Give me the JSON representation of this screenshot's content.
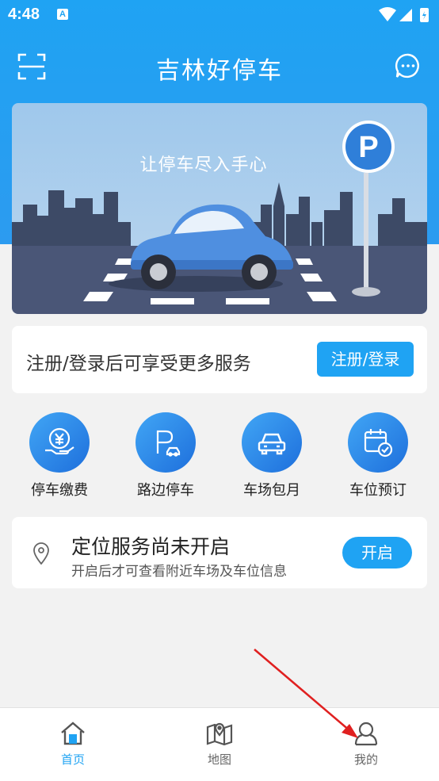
{
  "status_bar": {
    "time": "4:48",
    "notification_letter": "A"
  },
  "header": {
    "title": "吉林好停车",
    "scan_icon": "scan-icon",
    "message_icon": "chat-bubble-icon"
  },
  "banner": {
    "slogan": "让停车尽入手心",
    "sign_letter": "P"
  },
  "login": {
    "text": "注册/登录后可享受更多服务",
    "button": "注册/登录"
  },
  "services": [
    {
      "label": "停车缴费",
      "icon": "parking-payment-icon"
    },
    {
      "label": "路边停车",
      "icon": "roadside-parking-icon"
    },
    {
      "label": "车场包月",
      "icon": "monthly-parking-icon"
    },
    {
      "label": "车位预订",
      "icon": "space-reservation-icon"
    }
  ],
  "location": {
    "title": "定位服务尚未开启",
    "subtitle": "开启后才可查看附近车场及车位信息",
    "button": "开启",
    "icon": "location-pin-icon"
  },
  "tabs": [
    {
      "label": "首页",
      "icon": "home-icon",
      "active": true
    },
    {
      "label": "地图",
      "icon": "map-icon",
      "active": false
    },
    {
      "label": "我的",
      "icon": "user-icon",
      "active": false
    }
  ],
  "colors": {
    "primary": "#1fa3f3",
    "icon_gradient_start": "#41a6f5",
    "icon_gradient_end": "#1e6fdc",
    "annotation_arrow": "#e02020"
  }
}
